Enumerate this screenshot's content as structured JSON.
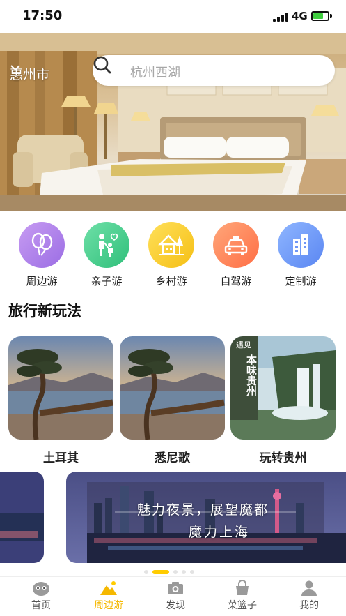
{
  "status_bar": {
    "time": "17:50",
    "network": "4G"
  },
  "header": {
    "city": "惠州市",
    "search_placeholder": "杭州西湖"
  },
  "categories": [
    {
      "label": "周边游",
      "icon": "balloon-icon",
      "color_from": "#c79cf2",
      "color_to": "#9b6de4"
    },
    {
      "label": "亲子游",
      "icon": "family-icon",
      "color_from": "#6fe0a8",
      "color_to": "#2fbf7a"
    },
    {
      "label": "乡村游",
      "icon": "house-icon",
      "color_from": "#ffe05a",
      "color_to": "#f5bf14"
    },
    {
      "label": "自驾游",
      "icon": "car-icon",
      "color_from": "#ffa77a",
      "color_to": "#ff6e45"
    },
    {
      "label": "定制游",
      "icon": "building-icon",
      "color_from": "#8fb6ff",
      "color_to": "#5a86f2"
    }
  ],
  "section": {
    "title": "旅行新玩法"
  },
  "destinations": [
    {
      "label": "土耳其"
    },
    {
      "label": "悉尼歌"
    },
    {
      "label": "玩转贵州",
      "poster_tag": "遇见",
      "poster_title": "本味贵州"
    }
  ],
  "banner": {
    "line1": "魅力夜景，展望魔都",
    "line2": "魔力上海"
  },
  "tabbar": {
    "items": [
      {
        "label": "首页",
        "icon": "home-mascot-icon",
        "active": false
      },
      {
        "label": "周边游",
        "icon": "mountain-icon",
        "active": true
      },
      {
        "label": "发现",
        "icon": "camera-icon",
        "active": false
      },
      {
        "label": "菜篮子",
        "icon": "basket-icon",
        "active": false
      },
      {
        "label": "我的",
        "icon": "user-icon",
        "active": false
      }
    ]
  },
  "colors": {
    "accent": "#ffcc00",
    "tab_active": "#f5b800"
  }
}
